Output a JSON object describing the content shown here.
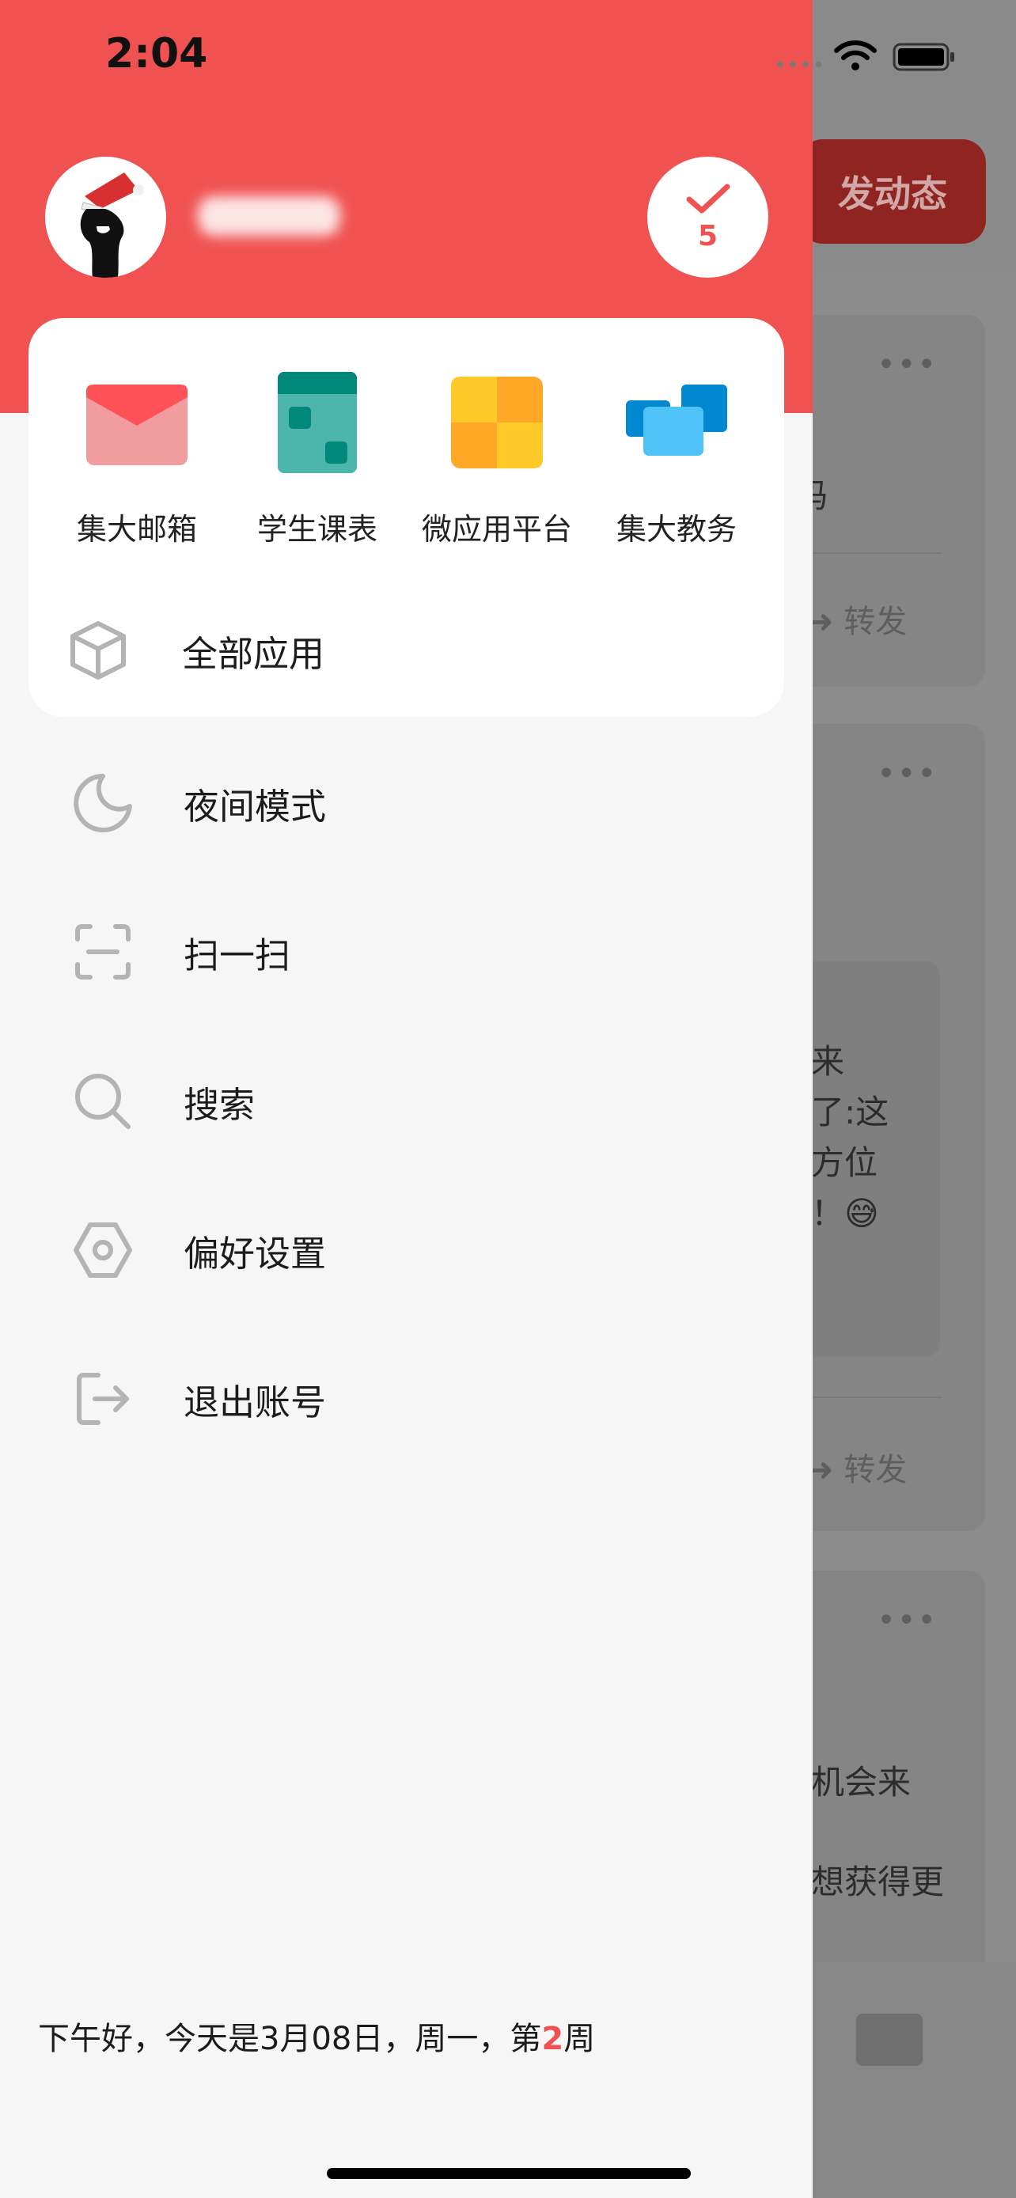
{
  "status_bar": {
    "time": "2:04"
  },
  "header": {
    "checkin_count": "5"
  },
  "background_feed": {
    "post_button_label": "发动态",
    "card1_text": "码",
    "card1_forward": "转发",
    "card2_text_lines": [
      "来",
      "了:这",
      "方位",
      "！😅"
    ],
    "card2_forward": "转发",
    "card3_text_lines": [
      "机会来",
      "想获得更"
    ]
  },
  "apps": [
    {
      "label": "集大邮箱",
      "icon": "mail-icon"
    },
    {
      "label": "学生课表",
      "icon": "timetable-icon"
    },
    {
      "label": "微应用平台",
      "icon": "micro-app-platform-icon"
    },
    {
      "label": "集大教务",
      "icon": "academic-affairs-icon"
    }
  ],
  "all_apps_label": "全部应用",
  "menu": [
    {
      "label": "夜间模式",
      "icon": "moon-icon"
    },
    {
      "label": "扫一扫",
      "icon": "scan-icon"
    },
    {
      "label": "搜索",
      "icon": "search-icon"
    },
    {
      "label": "偏好设置",
      "icon": "settings-icon"
    },
    {
      "label": "退出账号",
      "icon": "logout-icon"
    }
  ],
  "greeting": {
    "prefix": "下午好，今天是3月08日，周一，第",
    "week": "2",
    "suffix": "周"
  },
  "colors": {
    "brand_red": "#f05252",
    "drawer_bg": "#f6f6f6"
  }
}
